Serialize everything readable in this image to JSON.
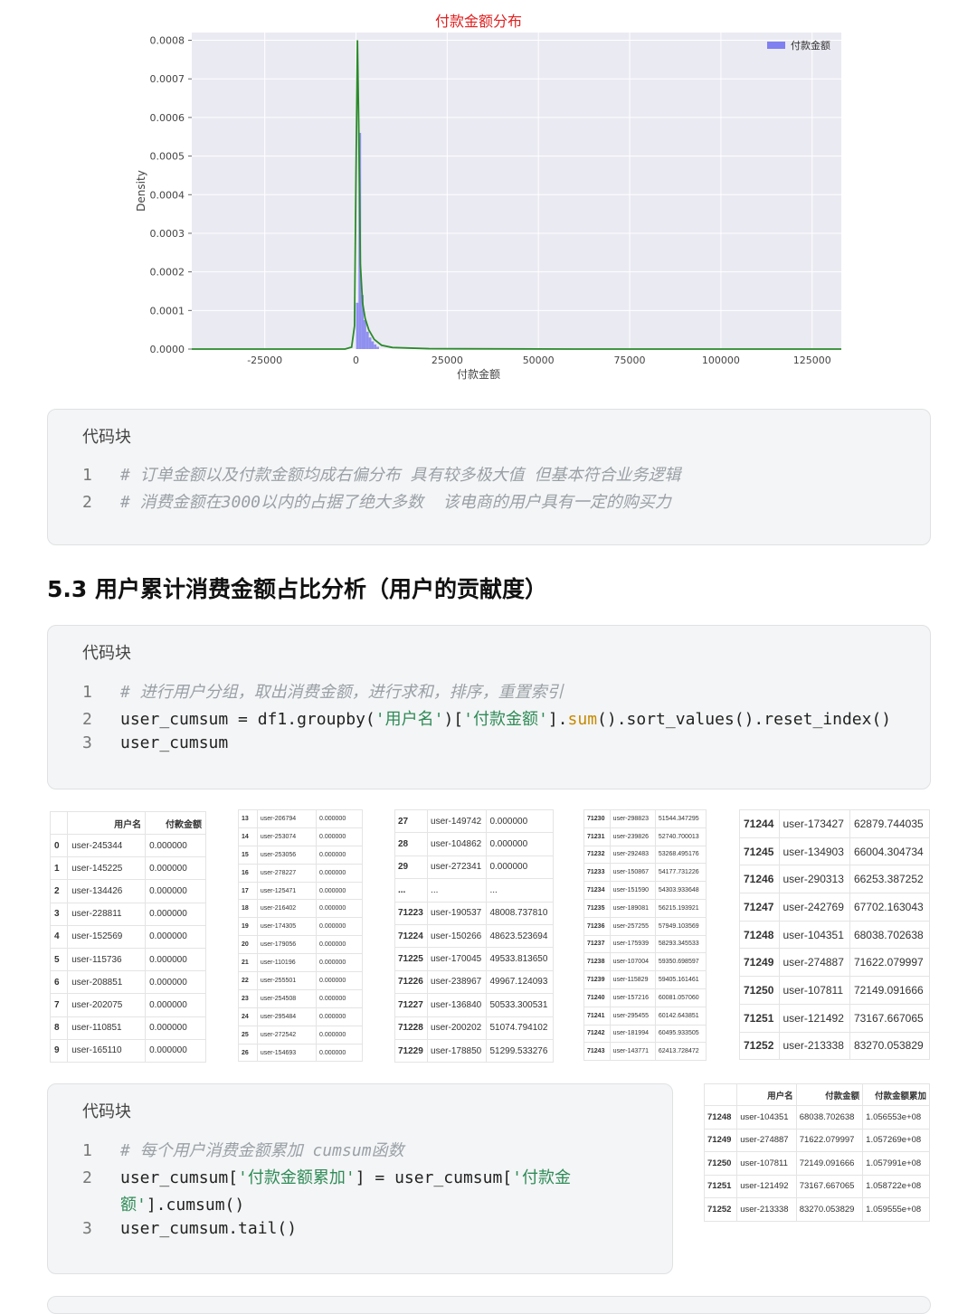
{
  "chart_data": {
    "type": "histogram_kde",
    "title": "付款金额分布",
    "xlabel": "付款金额",
    "ylabel": "Density",
    "legend": "付款金额",
    "legend_position": "top-right",
    "grid": true,
    "xlim": [
      -45000,
      133000
    ],
    "ylim": [
      0,
      0.00082
    ],
    "x_ticks": [
      -25000,
      0,
      25000,
      50000,
      75000,
      100000,
      125000
    ],
    "x_tick_labels": [
      "-25000",
      "0",
      "25000",
      "50000",
      "75000",
      "100000",
      "125000"
    ],
    "y_ticks": [
      0,
      0.0001,
      0.0002,
      0.0003,
      0.0004,
      0.0005,
      0.0006,
      0.0007,
      0.0008
    ],
    "y_tick_labels": [
      "0.0000",
      "0.0001",
      "0.0002",
      "0.0003",
      "0.0004",
      "0.0005",
      "0.0006",
      "0.0007",
      "0.0008"
    ],
    "histogram": {
      "bin_edges": [
        0,
        700,
        1400,
        2100,
        2800,
        3500,
        4200,
        4900,
        5600,
        6300
      ],
      "density": [
        0.00012,
        0.00056,
        0.00014,
        7.5e-05,
        4.5e-05,
        3e-05,
        2e-05,
        1.2e-05,
        6e-06
      ]
    },
    "kde": {
      "x": [
        -45000,
        -3000,
        -1200,
        -400,
        0,
        400,
        800,
        1200,
        1800,
        2500,
        3500,
        5000,
        7000,
        10000,
        20000,
        60000,
        133000
      ],
      "y": [
        0,
        0,
        5e-06,
        6e-05,
        0.00045,
        0.0008,
        0.00055,
        0.00022,
        0.00012,
        8e-05,
        5e-05,
        2.5e-05,
        1e-05,
        4e-06,
        1e-06,
        0,
        0
      ]
    },
    "colors": {
      "hist": "#8080f0",
      "kde": "#2a8a2a",
      "title": "#e02020",
      "plot_bg": "#eaeaf2"
    }
  },
  "code_block_1": {
    "title": "代码块",
    "lines": [
      {
        "num": "1",
        "comment": "# 订单金额以及付款金额均成右偏分布 具有较多极大值 但基本符合业务逻辑"
      },
      {
        "num": "2",
        "comment": "# 消费金额在3000以内的占据了绝大多数  该电商的用户具有一定的购买力"
      }
    ]
  },
  "section_heading": "5.3 用户累计消费金额占比分析（用户的贡献度）",
  "code_block_2": {
    "title": "代码块",
    "line1_num": "1",
    "line1_comment": "# 进行用户分组，取出消费金额，进行求和，排序，重置索引",
    "line2_num": "2",
    "line2_a": "user_cumsum = df1.groupby(",
    "line2_str1": "'用户名'",
    "line2_b": ")[",
    "line2_str2": "'付款金额'",
    "line2_c": "].",
    "line2_fn": "sum",
    "line2_d": "().sort_values().reset_index()",
    "line3_num": "3",
    "line3": "user_cumsum"
  },
  "table1": {
    "headers": [
      "",
      "用户名",
      "付款金额"
    ],
    "rows": [
      [
        "0",
        "user-245344",
        "0.000000"
      ],
      [
        "1",
        "user-145225",
        "0.000000"
      ],
      [
        "2",
        "user-134426",
        "0.000000"
      ],
      [
        "3",
        "user-228811",
        "0.000000"
      ],
      [
        "4",
        "user-152569",
        "0.000000"
      ],
      [
        "5",
        "user-115736",
        "0.000000"
      ],
      [
        "6",
        "user-208851",
        "0.000000"
      ],
      [
        "7",
        "user-202075",
        "0.000000"
      ],
      [
        "8",
        "user-110851",
        "0.000000"
      ],
      [
        "9",
        "user-165110",
        "0.000000"
      ]
    ]
  },
  "table2": {
    "rows": [
      [
        "13",
        "user-206794",
        "0.000000"
      ],
      [
        "14",
        "user-253074",
        "0.000000"
      ],
      [
        "15",
        "user-253056",
        "0.000000"
      ],
      [
        "16",
        "user-278227",
        "0.000000"
      ],
      [
        "17",
        "user-125471",
        "0.000000"
      ],
      [
        "18",
        "user-216402",
        "0.000000"
      ],
      [
        "19",
        "user-174305",
        "0.000000"
      ],
      [
        "20",
        "user-179056",
        "0.000000"
      ],
      [
        "21",
        "user-110196",
        "0.000000"
      ],
      [
        "22",
        "user-255501",
        "0.000000"
      ],
      [
        "23",
        "user-254508",
        "0.000000"
      ],
      [
        "24",
        "user-295484",
        "0.000000"
      ],
      [
        "25",
        "user-272542",
        "0.000000"
      ],
      [
        "26",
        "user-154693",
        "0.000000"
      ]
    ]
  },
  "table3": {
    "rows": [
      [
        "27",
        "user-149742",
        "0.000000"
      ],
      [
        "28",
        "user-104862",
        "0.000000"
      ],
      [
        "29",
        "user-272341",
        "0.000000"
      ],
      [
        "...",
        "...",
        "..."
      ],
      [
        "71223",
        "user-190537",
        "48008.737810"
      ],
      [
        "71224",
        "user-150266",
        "48623.523694"
      ],
      [
        "71225",
        "user-170045",
        "49533.813650"
      ],
      [
        "71226",
        "user-238967",
        "49967.124093"
      ],
      [
        "71227",
        "user-136840",
        "50533.300531"
      ],
      [
        "71228",
        "user-200202",
        "51074.794102"
      ],
      [
        "71229",
        "user-178850",
        "51299.533276"
      ]
    ]
  },
  "table4": {
    "rows": [
      [
        "71230",
        "user-298823",
        "51544.347295"
      ],
      [
        "71231",
        "user-239826",
        "52740.700013"
      ],
      [
        "71232",
        "user-292483",
        "53268.495176"
      ],
      [
        "71233",
        "user-150867",
        "54177.731226"
      ],
      [
        "71234",
        "user-151590",
        "54303.933648"
      ],
      [
        "71235",
        "user-189081",
        "56215.193921"
      ],
      [
        "71236",
        "user-257255",
        "57949.103569"
      ],
      [
        "71237",
        "user-175939",
        "58293.345533"
      ],
      [
        "71238",
        "user-107004",
        "59350.698597"
      ],
      [
        "71239",
        "user-115829",
        "59405.161461"
      ],
      [
        "71240",
        "user-157216",
        "60081.057060"
      ],
      [
        "71241",
        "user-295455",
        "60142.643851"
      ],
      [
        "71242",
        "user-181994",
        "60495.933505"
      ],
      [
        "71243",
        "user-143771",
        "62413.728472"
      ]
    ]
  },
  "table5": {
    "rows": [
      [
        "71244",
        "user-173427",
        "62879.744035"
      ],
      [
        "71245",
        "user-134903",
        "66004.304734"
      ],
      [
        "71246",
        "user-290313",
        "66253.387252"
      ],
      [
        "71247",
        "user-242769",
        "67702.163043"
      ],
      [
        "71248",
        "user-104351",
        "68038.702638"
      ],
      [
        "71249",
        "user-274887",
        "71622.079997"
      ],
      [
        "71250",
        "user-107811",
        "72149.091666"
      ],
      [
        "71251",
        "user-121492",
        "73167.667065"
      ],
      [
        "71252",
        "user-213338",
        "83270.053829"
      ]
    ]
  },
  "code_block_3": {
    "title": "代码块",
    "line1_num": "1",
    "line1_comment": "# 每个用户消费金额累加 cumsum函数",
    "line2_num": "2",
    "line2_a": "user_cumsum[",
    "line2_str1": "'付款金额累加'",
    "line2_b": "] = user_cumsum[",
    "line2_str2a": "'付款金",
    "line2b_str2b": "额'",
    "line2b_rest": "].cumsum()",
    "line3_num": "3",
    "line3": "user_cumsum.tail()"
  },
  "table6": {
    "headers": [
      "",
      "用户名",
      "付款金额",
      "付款金额累加"
    ],
    "rows": [
      [
        "71248",
        "user-104351",
        "68038.702638",
        "1.056553e+08"
      ],
      [
        "71249",
        "user-274887",
        "71622.079997",
        "1.057269e+08"
      ],
      [
        "71250",
        "user-107811",
        "72149.091666",
        "1.057991e+08"
      ],
      [
        "71251",
        "user-121492",
        "73167.667065",
        "1.058722e+08"
      ],
      [
        "71252",
        "user-213338",
        "83270.053829",
        "1.059555e+08"
      ]
    ]
  }
}
